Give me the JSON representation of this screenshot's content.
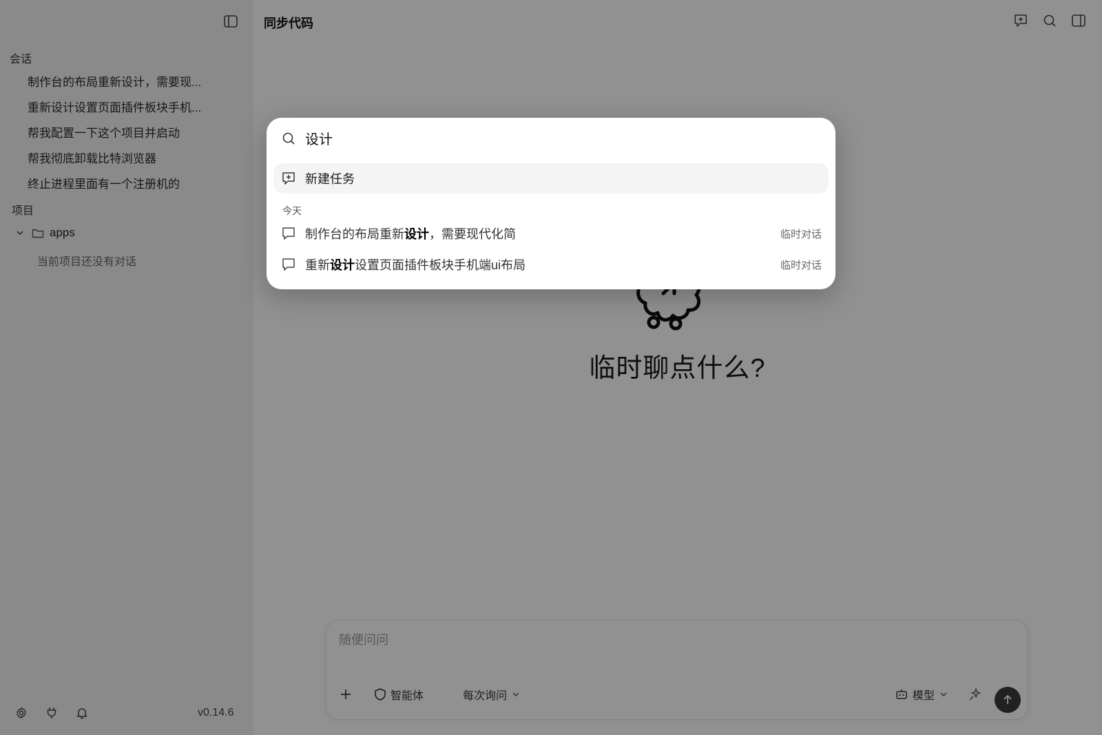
{
  "sidebar": {
    "sections_label": "会话",
    "sessions": [
      "制作台的布局重新设计，需要现...",
      "重新设计设置页面插件板块手机...",
      "帮我配置一下这个项目并启动",
      "帮我彻底卸载比特浏览器",
      "终止进程里面有一个注册机的"
    ],
    "projects_label": "项目",
    "project_name": "apps",
    "project_empty": "当前项目还没有对话",
    "version": "v0.14.6"
  },
  "main": {
    "title": "同步代码",
    "hero_text": "临时聊点什么?",
    "composer": {
      "placeholder": "随便问问",
      "agent_label": "智能体",
      "ask_mode_label": "每次询问",
      "model_label": "模型"
    }
  },
  "palette": {
    "query": "设计",
    "new_task_label": "新建任务",
    "group_label": "今天",
    "results": [
      {
        "before": "制作台的布局重新",
        "highlight": "设计",
        "after": "，需要现代化简",
        "tag": "临时对话"
      },
      {
        "before": "重新",
        "highlight": "设计",
        "after": "设置页面插件板块手机端ui布局",
        "tag": "临时对话"
      }
    ]
  },
  "colors": {
    "overlay": "#000000",
    "sidebar_bg": "#f3f3f3",
    "send_button": "#3a3a3a",
    "highlight_row": "#f4f4f4"
  }
}
